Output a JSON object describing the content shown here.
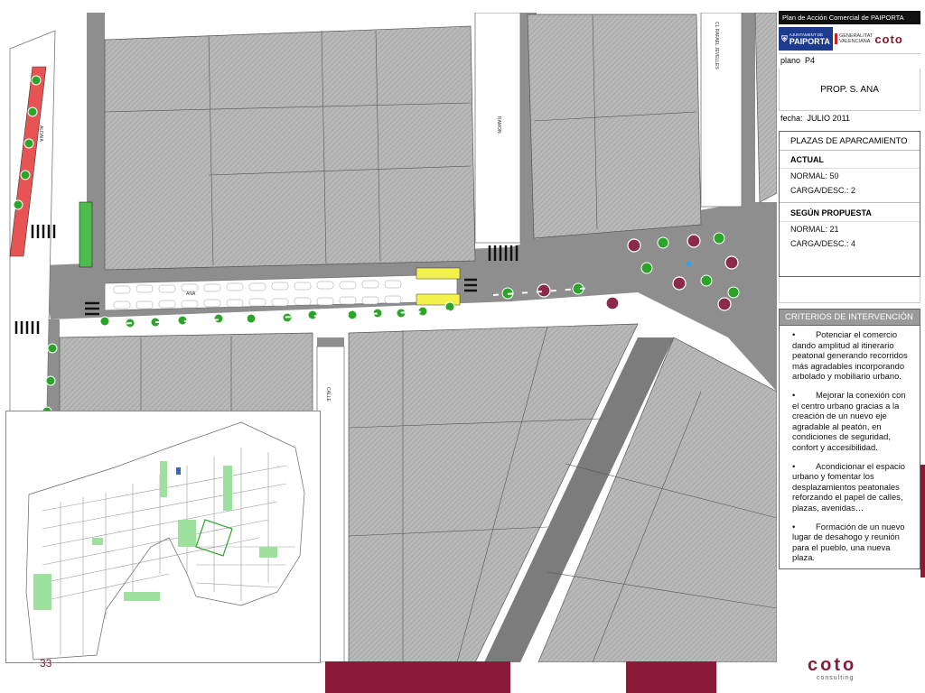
{
  "header": {
    "plan_title": "Plan de Acción Comercial de PAIPORTA"
  },
  "logos": {
    "paiporta": {
      "small": "AJUNTAMENT DE",
      "name": "PAIPORTA"
    },
    "generalitat": {
      "line1": "GENERALITAT",
      "line2": "VALENCIANA"
    },
    "coto": {
      "name": "coto",
      "sub": "consulting"
    }
  },
  "plano": {
    "label": "plano",
    "value": "P4"
  },
  "prop_title": "PROP. S. ANA",
  "fecha": {
    "label": "fecha:",
    "value": "JULIO 2011"
  },
  "parking": {
    "title": "PLAZAS DE APARCAMIENTO",
    "actual": {
      "heading": "ACTUAL",
      "normal": "NORMAL: 50",
      "carga": "CARGA/DESC.: 2"
    },
    "propuesta": {
      "heading": "SEGÚN PROPUESTA",
      "normal": "NORMAL: 21",
      "carga": "CARGA/DESC.: 4"
    }
  },
  "criteria": {
    "title": "CRITERIOS DE INTERVENCIÓN",
    "bullet": "•",
    "items": [
      "Potenciar el comercio dando amplitud al itinerario peatonal generando recorridos más agradables incorporando arbolado y mobiliario urbano.",
      "Mejorar la conexión con el centro urbano gracias a la creación de un nuevo eje agradable al peatón, en condiciones de seguridad, confort y accesibilidad.",
      "Acondicionar el espacio urbano y fomentar los desplazamientos peatonales reforzando el papel de calles, plazas, avenidas…",
      "Formación de un nuevo lugar de desahogo y reunión para el pueblo, una nueva plaza."
    ]
  },
  "map": {
    "street_labels": {
      "aldaia": "ALDAIA",
      "ramon": "RAMON",
      "ana": "ANA",
      "calle": "CALLE",
      "rafael": "CL RAFAEL JEVELLES"
    }
  },
  "footer": {
    "page_number": "33",
    "coto": "coto",
    "consulting": "consulting"
  },
  "colors": {
    "brand": "#8a1a38",
    "road": "#8c8c8c",
    "block": "#b4b4b4",
    "tree": "#2aa52a",
    "proposed_tree": "#8b2a4a",
    "bike_lane": "#e85454",
    "loading_zone": "#f2f24a"
  }
}
